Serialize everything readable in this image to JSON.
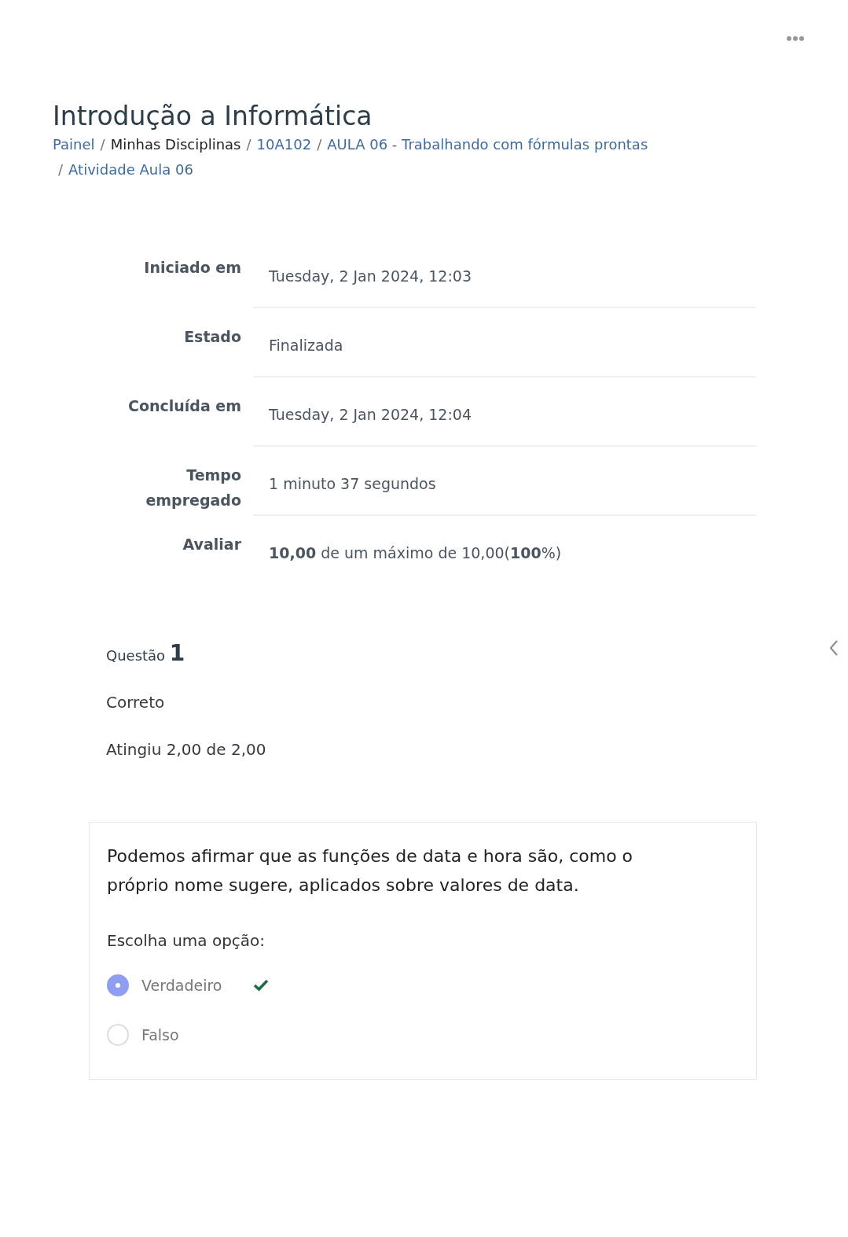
{
  "page_title": "Introdução a Informática",
  "breadcrumb": [
    {
      "label": "Painel",
      "link": true
    },
    {
      "separator": "/",
      "label": "Minhas Disciplinas",
      "link": false
    },
    {
      "separator": "/",
      "label": "10A102",
      "link": true
    },
    {
      "separator": "/",
      "label": "AULA 06 - Trabalhando com fórmulas prontas",
      "link": true
    },
    {
      "separator": "/",
      "label": "Atividade Aula 06",
      "link": true
    }
  ],
  "summary": [
    {
      "label": "Iniciado em",
      "value": "Tuesday, 2 Jan 2024, 12:03"
    },
    {
      "label": "Estado",
      "value": "Finalizada"
    },
    {
      "label": "Concluída em",
      "value": "Tuesday, 2 Jan 2024, 12:04"
    },
    {
      "label": "Tempo empregado",
      "value": "1 minuto 37 segundos"
    },
    {
      "label": "Avaliar",
      "value": "**10,00** de um máximo de 10,00(**100**%)"
    }
  ],
  "question": {
    "heading": "Questão",
    "number": "1",
    "state": "Correto",
    "grade": "Atingiu 2,00 de 2,00",
    "text": "Podemos afirmar que as funções de data e hora são, como o próprio nome sugere, aplicados sobre valores de data.",
    "prompt": "Escolha uma opção:",
    "options": [
      {
        "label": "Verdadeiro",
        "selected": true,
        "correct": true
      },
      {
        "label": "Falso",
        "selected": false,
        "correct": false
      }
    ]
  }
}
